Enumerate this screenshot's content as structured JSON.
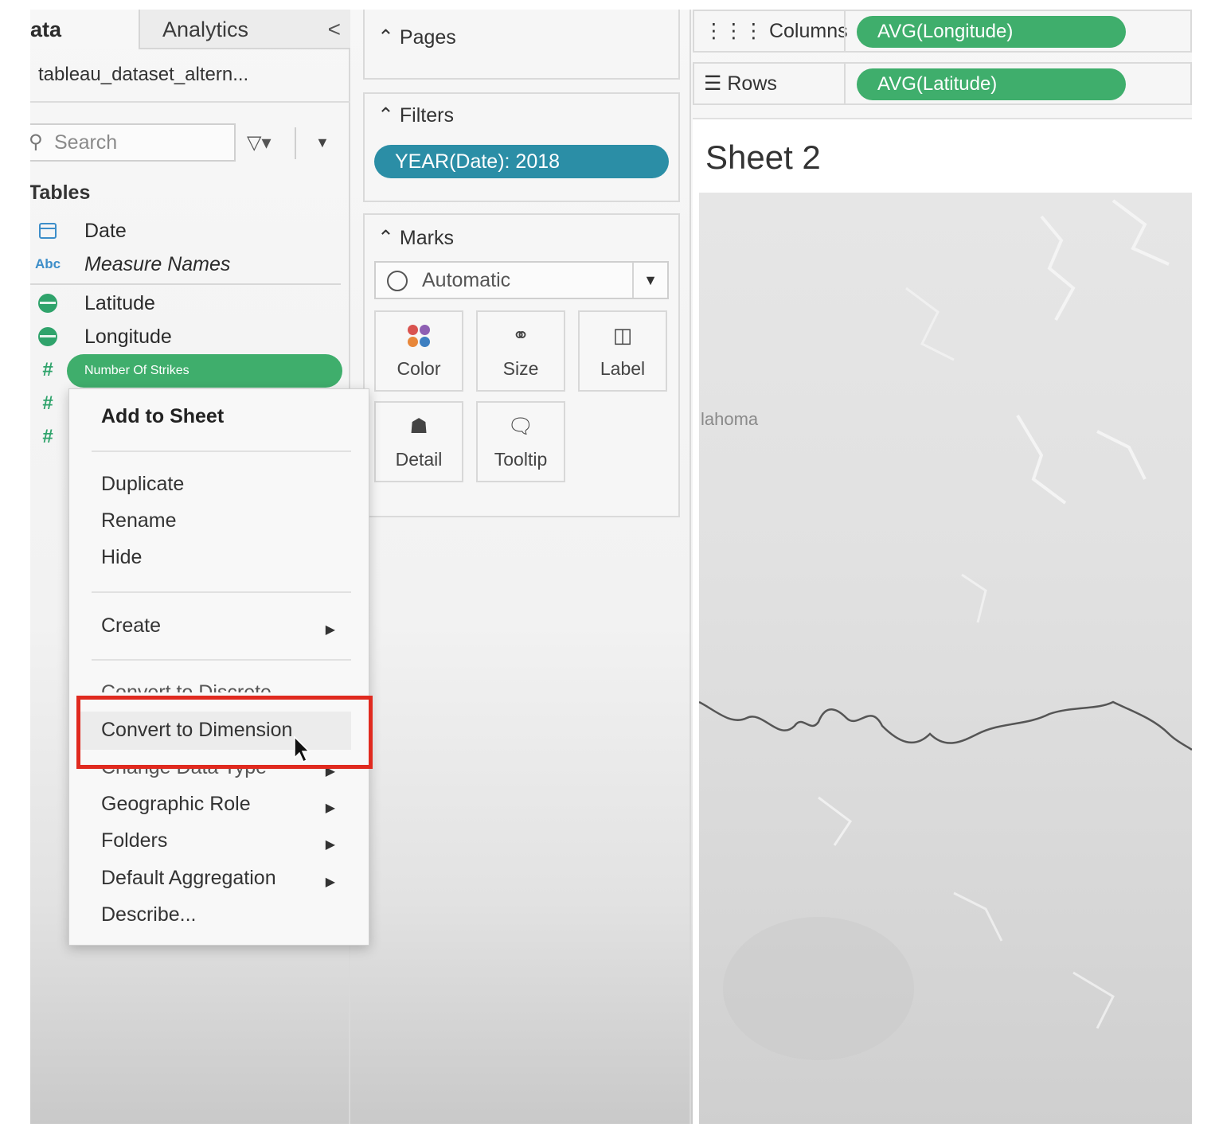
{
  "data_pane": {
    "tab_data": "ata",
    "tab_analytics": "Analytics",
    "collapse_glyph": "<",
    "datasource": "tableau_dataset_altern...",
    "search_placeholder": "Search",
    "tables_heading": "Tables",
    "fields": [
      {
        "label": "Date",
        "icon": "calendar-icon"
      },
      {
        "label": "Measure Names",
        "icon": "abc-icon"
      },
      {
        "label": "Latitude",
        "icon": "globe-icon"
      },
      {
        "label": "Longitude",
        "icon": "globe-icon"
      },
      {
        "label": "Number Of Strikes",
        "icon": "number-icon"
      }
    ],
    "abc_glyph": "Abc",
    "hash_glyph": "#"
  },
  "shelves": {
    "pages_title": "Pages",
    "filters_title": "Filters",
    "filter_pill": "YEAR(Date): 2018",
    "marks_title": "Marks",
    "mark_type": "Automatic",
    "mark_buttons": [
      {
        "label": "Color",
        "icon": "color-icon"
      },
      {
        "label": "Size",
        "icon": "size-icon"
      },
      {
        "label": "Label",
        "icon": "label-icon"
      },
      {
        "label": "Detail",
        "icon": "detail-icon"
      },
      {
        "label": "Tooltip",
        "icon": "tooltip-icon"
      }
    ]
  },
  "view": {
    "columns_label": "Columns",
    "columns_pill": "AVG(Longitude)",
    "rows_label": "Rows",
    "rows_pill": "AVG(Latitude)",
    "sheet_title": "Sheet 2",
    "map_label": "lahoma"
  },
  "context_menu": {
    "add_to_sheet": "Add to Sheet",
    "duplicate": "Duplicate",
    "rename": "Rename",
    "hide": "Hide",
    "create": "Create",
    "convert_to_discrete": "Convert to Discrete",
    "convert_to_dimension": "Convert to Dimension",
    "change_data_type": "Change Data Type",
    "geographic_role": "Geographic Role",
    "folders": "Folders",
    "default_aggregation": "Default Aggregation",
    "describe": "Describe..."
  },
  "colors": {
    "measure_green": "#3fae6c",
    "filter_teal": "#2b8ea6",
    "highlight_red": "#e02a1f",
    "dimension_blue": "#3d8ec9"
  }
}
